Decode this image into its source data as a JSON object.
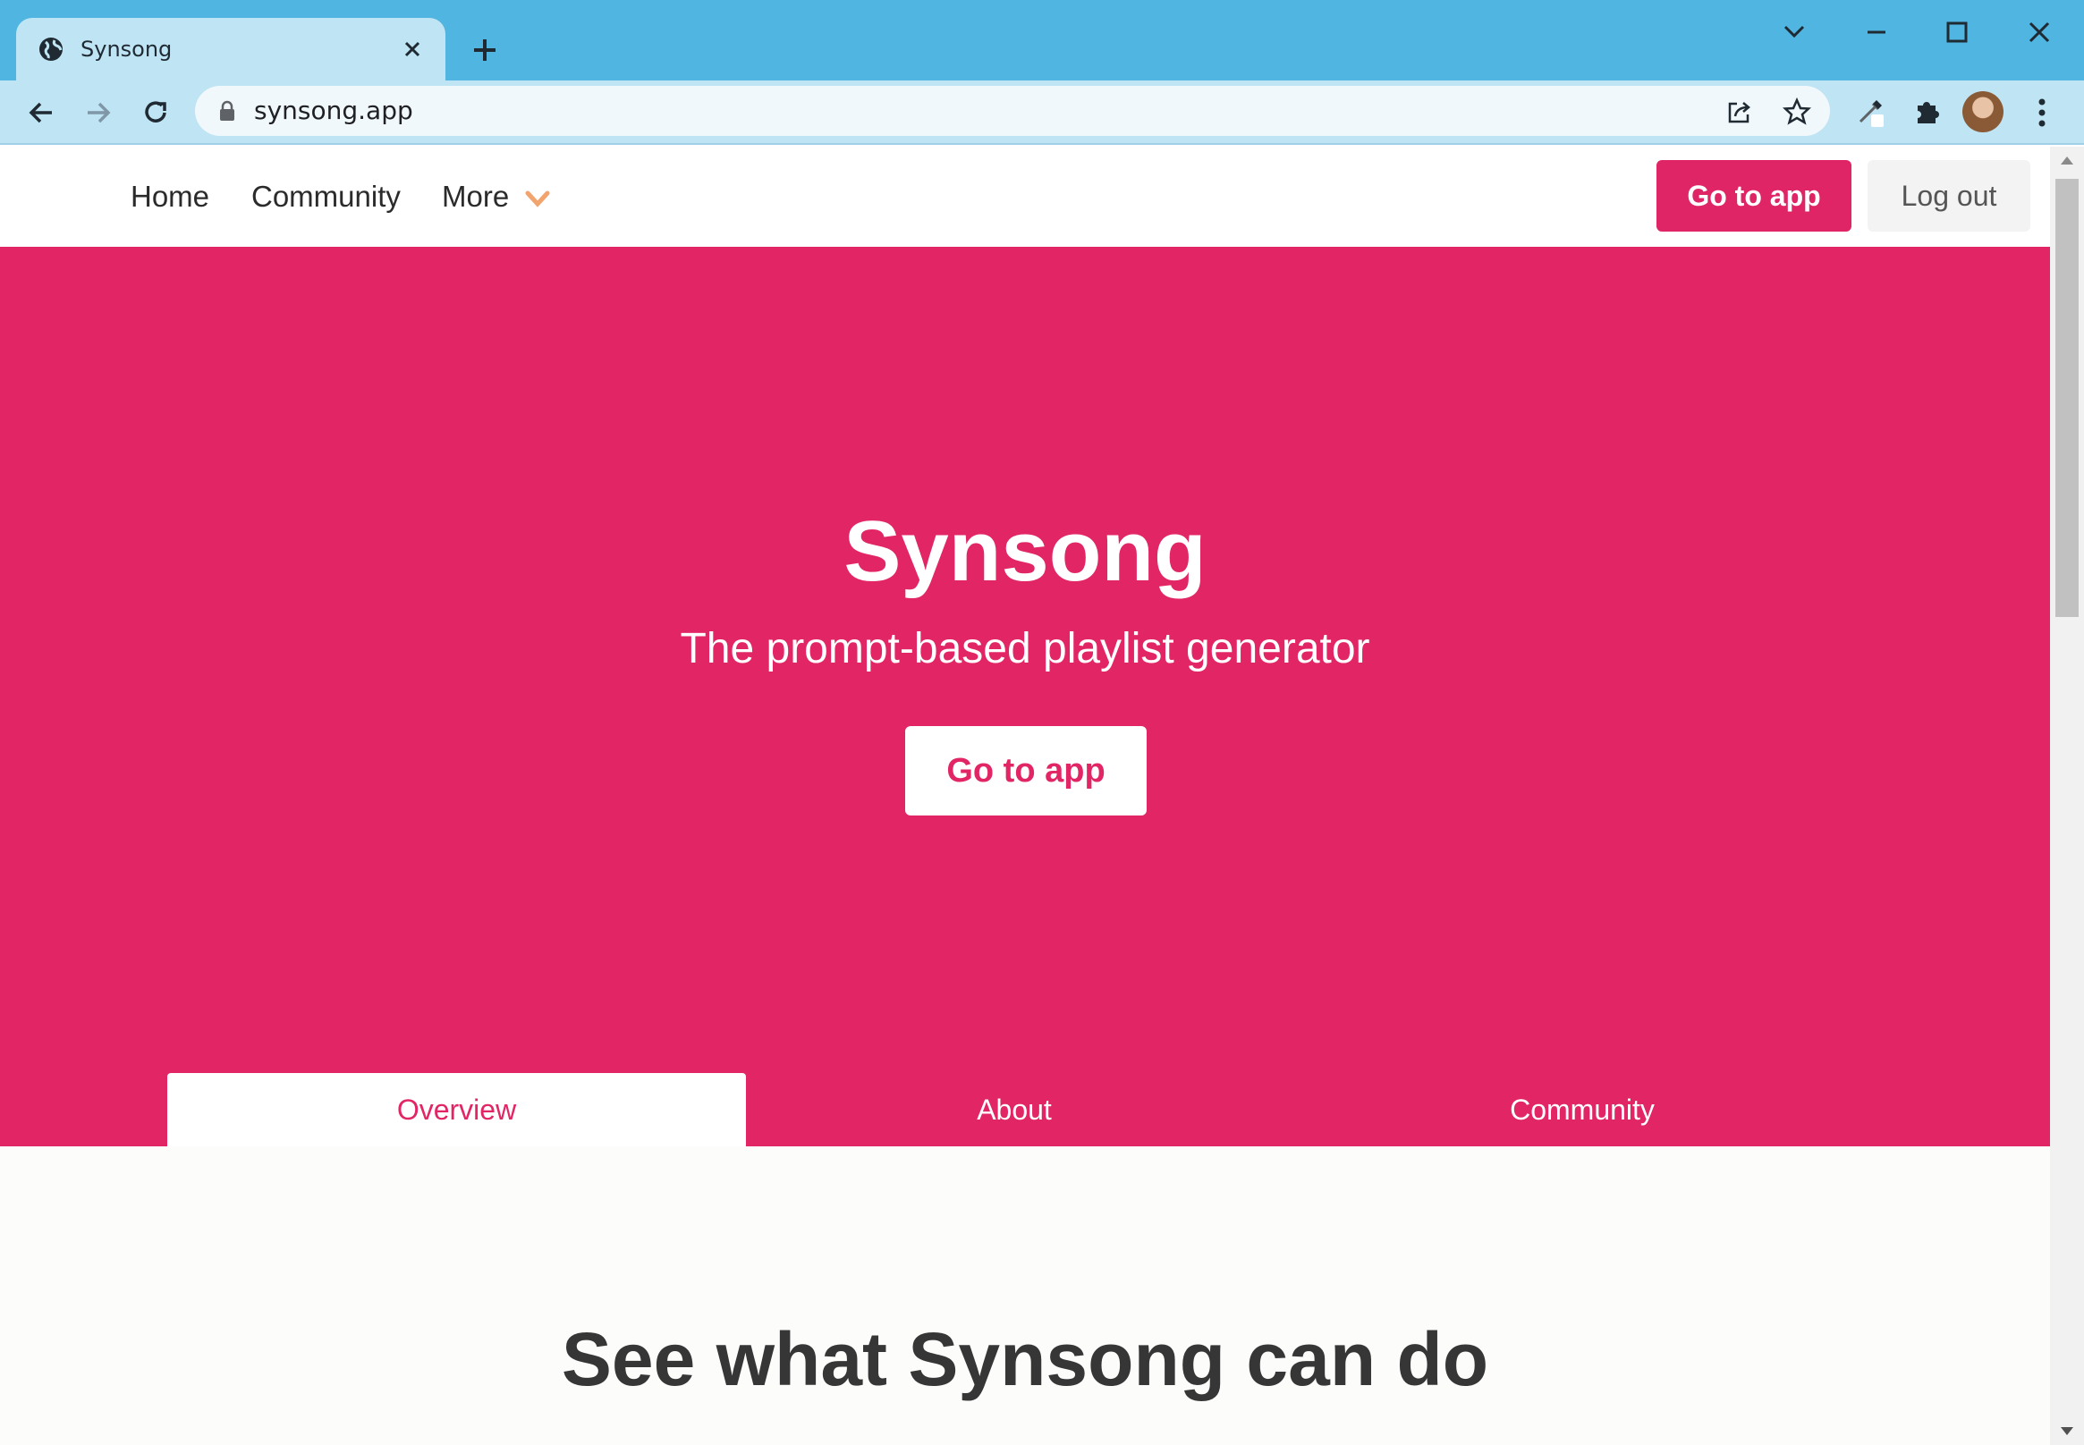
{
  "browser": {
    "tab_title": "Synsong",
    "url": "synsong.app"
  },
  "site_nav": {
    "links": [
      "Home",
      "Community",
      "More"
    ],
    "go_to_app": "Go to app",
    "log_out": "Log out"
  },
  "hero": {
    "title": "Synsong",
    "subtitle": "The prompt-based playlist generator",
    "cta": "Go to app",
    "tabs": [
      {
        "label": "Overview",
        "active": true
      },
      {
        "label": "About",
        "active": false
      },
      {
        "label": "Community",
        "active": false
      }
    ]
  },
  "section": {
    "title": "See what Synsong can do"
  },
  "colors": {
    "brand": "#e22564",
    "chrome": "#50b5e1",
    "chevron": "#f2a46f"
  }
}
